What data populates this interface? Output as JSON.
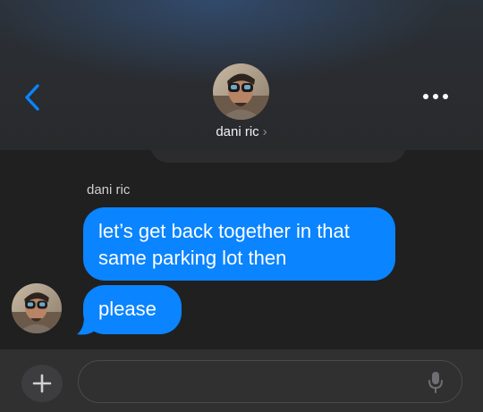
{
  "header": {
    "contact_name": "dani ric",
    "name_chevron": "›",
    "back_icon": "chevron-left-icon",
    "more_icon": "ellipsis-icon"
  },
  "conversation": {
    "sender_label": "dani ric",
    "messages": [
      {
        "text": "let’s get back together in that same parking lot then"
      },
      {
        "text": "please"
      }
    ]
  },
  "composer": {
    "plus_icon": "plus-icon",
    "input_value": "",
    "mic_icon": "microphone-icon"
  },
  "colors": {
    "bubble_blue": "#0a84ff",
    "accent_blue": "#0a84ff",
    "background": "#202020"
  }
}
